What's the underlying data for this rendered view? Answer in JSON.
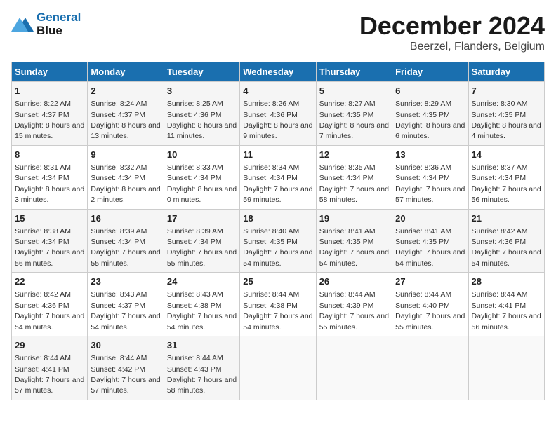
{
  "logo": {
    "line1": "General",
    "line2": "Blue"
  },
  "title": "December 2024",
  "subtitle": "Beerzel, Flanders, Belgium",
  "headers": [
    "Sunday",
    "Monday",
    "Tuesday",
    "Wednesday",
    "Thursday",
    "Friday",
    "Saturday"
  ],
  "weeks": [
    [
      {
        "day": "1",
        "sunrise": "8:22 AM",
        "sunset": "4:37 PM",
        "daylight": "8 hours and 15 minutes."
      },
      {
        "day": "2",
        "sunrise": "8:24 AM",
        "sunset": "4:37 PM",
        "daylight": "8 hours and 13 minutes."
      },
      {
        "day": "3",
        "sunrise": "8:25 AM",
        "sunset": "4:36 PM",
        "daylight": "8 hours and 11 minutes."
      },
      {
        "day": "4",
        "sunrise": "8:26 AM",
        "sunset": "4:36 PM",
        "daylight": "8 hours and 9 minutes."
      },
      {
        "day": "5",
        "sunrise": "8:27 AM",
        "sunset": "4:35 PM",
        "daylight": "8 hours and 7 minutes."
      },
      {
        "day": "6",
        "sunrise": "8:29 AM",
        "sunset": "4:35 PM",
        "daylight": "8 hours and 6 minutes."
      },
      {
        "day": "7",
        "sunrise": "8:30 AM",
        "sunset": "4:35 PM",
        "daylight": "8 hours and 4 minutes."
      }
    ],
    [
      {
        "day": "8",
        "sunrise": "8:31 AM",
        "sunset": "4:34 PM",
        "daylight": "8 hours and 3 minutes."
      },
      {
        "day": "9",
        "sunrise": "8:32 AM",
        "sunset": "4:34 PM",
        "daylight": "8 hours and 2 minutes."
      },
      {
        "day": "10",
        "sunrise": "8:33 AM",
        "sunset": "4:34 PM",
        "daylight": "8 hours and 0 minutes."
      },
      {
        "day": "11",
        "sunrise": "8:34 AM",
        "sunset": "4:34 PM",
        "daylight": "7 hours and 59 minutes."
      },
      {
        "day": "12",
        "sunrise": "8:35 AM",
        "sunset": "4:34 PM",
        "daylight": "7 hours and 58 minutes."
      },
      {
        "day": "13",
        "sunrise": "8:36 AM",
        "sunset": "4:34 PM",
        "daylight": "7 hours and 57 minutes."
      },
      {
        "day": "14",
        "sunrise": "8:37 AM",
        "sunset": "4:34 PM",
        "daylight": "7 hours and 56 minutes."
      }
    ],
    [
      {
        "day": "15",
        "sunrise": "8:38 AM",
        "sunset": "4:34 PM",
        "daylight": "7 hours and 56 minutes."
      },
      {
        "day": "16",
        "sunrise": "8:39 AM",
        "sunset": "4:34 PM",
        "daylight": "7 hours and 55 minutes."
      },
      {
        "day": "17",
        "sunrise": "8:39 AM",
        "sunset": "4:34 PM",
        "daylight": "7 hours and 55 minutes."
      },
      {
        "day": "18",
        "sunrise": "8:40 AM",
        "sunset": "4:35 PM",
        "daylight": "7 hours and 54 minutes."
      },
      {
        "day": "19",
        "sunrise": "8:41 AM",
        "sunset": "4:35 PM",
        "daylight": "7 hours and 54 minutes."
      },
      {
        "day": "20",
        "sunrise": "8:41 AM",
        "sunset": "4:35 PM",
        "daylight": "7 hours and 54 minutes."
      },
      {
        "day": "21",
        "sunrise": "8:42 AM",
        "sunset": "4:36 PM",
        "daylight": "7 hours and 54 minutes."
      }
    ],
    [
      {
        "day": "22",
        "sunrise": "8:42 AM",
        "sunset": "4:36 PM",
        "daylight": "7 hours and 54 minutes."
      },
      {
        "day": "23",
        "sunrise": "8:43 AM",
        "sunset": "4:37 PM",
        "daylight": "7 hours and 54 minutes."
      },
      {
        "day": "24",
        "sunrise": "8:43 AM",
        "sunset": "4:38 PM",
        "daylight": "7 hours and 54 minutes."
      },
      {
        "day": "25",
        "sunrise": "8:44 AM",
        "sunset": "4:38 PM",
        "daylight": "7 hours and 54 minutes."
      },
      {
        "day": "26",
        "sunrise": "8:44 AM",
        "sunset": "4:39 PM",
        "daylight": "7 hours and 55 minutes."
      },
      {
        "day": "27",
        "sunrise": "8:44 AM",
        "sunset": "4:40 PM",
        "daylight": "7 hours and 55 minutes."
      },
      {
        "day": "28",
        "sunrise": "8:44 AM",
        "sunset": "4:41 PM",
        "daylight": "7 hours and 56 minutes."
      }
    ],
    [
      {
        "day": "29",
        "sunrise": "8:44 AM",
        "sunset": "4:41 PM",
        "daylight": "7 hours and 57 minutes."
      },
      {
        "day": "30",
        "sunrise": "8:44 AM",
        "sunset": "4:42 PM",
        "daylight": "7 hours and 57 minutes."
      },
      {
        "day": "31",
        "sunrise": "8:44 AM",
        "sunset": "4:43 PM",
        "daylight": "7 hours and 58 minutes."
      },
      null,
      null,
      null,
      null
    ]
  ]
}
